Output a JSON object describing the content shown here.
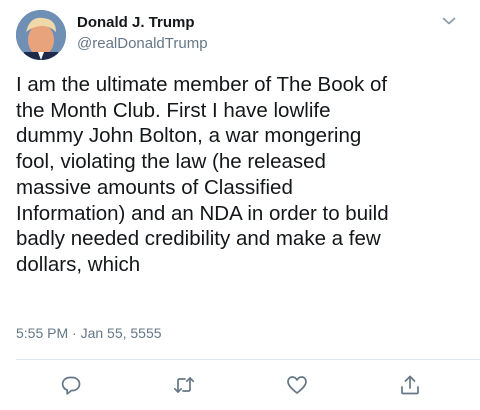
{
  "tweet": {
    "author": {
      "display_name": "Donald J. Trump",
      "handle": "@realDonaldTrump",
      "avatar_icon": "profile-photo"
    },
    "text": "I am the ultimate member of The Book of\nthe Month Club. First I have lowlife\ndummy John Bolton, a war mongering\nfool, violating the law (he released\nmassive amounts of Classified\nInformation) and an NDA in order to build\nbadly needed credibility and make a few\ndollars, which",
    "timestamp": "5:55 PM · Jan 55, 5555",
    "actions": [
      {
        "name": "reply",
        "icon": "speech-bubble-icon"
      },
      {
        "name": "retweet",
        "icon": "retweet-arrows-icon"
      },
      {
        "name": "like",
        "icon": "heart-icon"
      },
      {
        "name": "share",
        "icon": "share-upload-icon"
      }
    ]
  },
  "colors": {
    "text_primary": "#14171a",
    "text_secondary": "#657786",
    "divider": "#e1e8ed",
    "icon": "#657786"
  }
}
